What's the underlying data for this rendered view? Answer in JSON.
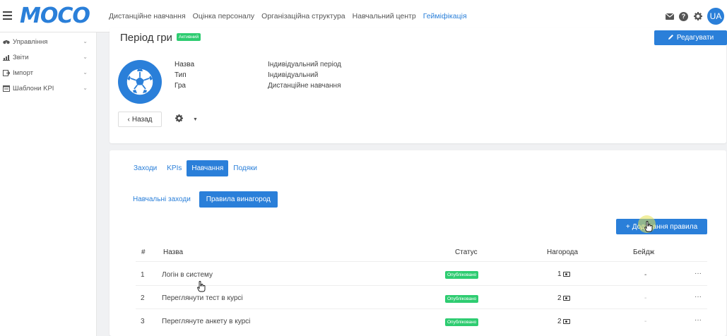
{
  "topbar": {
    "logo": "MOCO",
    "nav": [
      {
        "label": "Дистанційне навчання",
        "active": false
      },
      {
        "label": "Оцінка персоналу",
        "active": false
      },
      {
        "label": "Організаційна структура",
        "active": false
      },
      {
        "label": "Навчальний центр",
        "active": false
      },
      {
        "label": "Гейміфікація",
        "active": true
      }
    ],
    "avatar": "UA"
  },
  "sidebar": {
    "items": [
      {
        "label": "Управління",
        "icon": "binoculars-icon"
      },
      {
        "label": "Звіти",
        "icon": "bar-chart-icon"
      },
      {
        "label": "Імпорт",
        "icon": "import-icon"
      },
      {
        "label": "Шаблони KPI",
        "icon": "template-icon"
      }
    ]
  },
  "header": {
    "title": "Період гри",
    "status": "Активний",
    "edit_label": "Редагувати",
    "back_label": "Назад"
  },
  "info": [
    {
      "key": "Назва",
      "value": "Індивідуальний період"
    },
    {
      "key": "Тип",
      "value": "Індивідуальний"
    },
    {
      "key": "Гра",
      "value": "Дистанційне навчання"
    }
  ],
  "tabs": [
    {
      "label": "Заходи",
      "active": false
    },
    {
      "label": "KPIs",
      "active": false
    },
    {
      "label": "Навчання",
      "active": true
    },
    {
      "label": "Подяки",
      "active": false
    }
  ],
  "subtabs": [
    {
      "label": "Навчальні заходи",
      "active": false
    },
    {
      "label": "Правила винагород",
      "active": true
    }
  ],
  "add_rule_label": "Додавання правила",
  "table": {
    "headers": {
      "num": "#",
      "name": "Назва",
      "status": "Статус",
      "reward": "Нагорода",
      "badge": "Бейдж"
    },
    "rows": [
      {
        "num": "1",
        "name": "Логін в систему",
        "status": "Опубліковано",
        "reward": "1",
        "badge": "-",
        "actions": "···"
      },
      {
        "num": "2",
        "name": "Переглянути тест в курсі",
        "status": "Опубліковано",
        "reward": "2",
        "badge": "-",
        "actions": "···"
      },
      {
        "num": "3",
        "name": "Переглянуте анкету в курсі",
        "status": "Опубліковано",
        "reward": "2",
        "badge": "-",
        "actions": "···"
      }
    ]
  },
  "colors": {
    "primary": "#2a7fd9",
    "success": "#2ecc71"
  }
}
